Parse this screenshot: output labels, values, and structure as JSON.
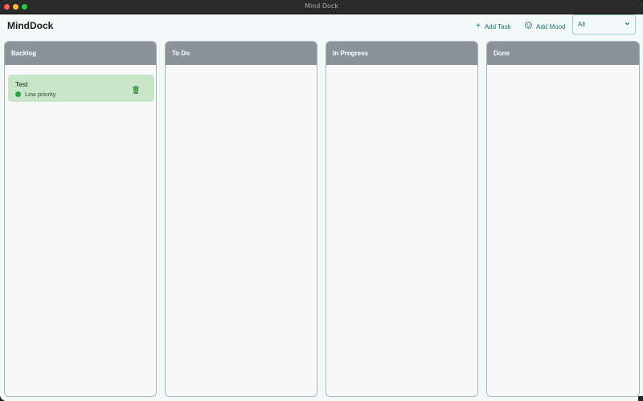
{
  "window": {
    "title": "Mind Dock"
  },
  "header": {
    "app_title": "MindDock",
    "add_task_label": "Add Task",
    "add_mood_label": "Add Mood",
    "filter_value": "All"
  },
  "columns": [
    {
      "title": "Backlog",
      "cards": [
        {
          "title": "Test",
          "priority": "Low priority",
          "priority_color": "#2ea043"
        }
      ]
    },
    {
      "title": "To Do",
      "cards": []
    },
    {
      "title": "In Progress",
      "cards": []
    },
    {
      "title": "Done",
      "cards": []
    }
  ],
  "colors": {
    "accent": "#1a6e74",
    "column_header": "#8a9399",
    "card_background": "#c9e6c9",
    "delete_icon": "#3d8c3d"
  },
  "icons": {
    "add_task": "plus-icon",
    "add_mood": "smiley-icon",
    "filter": "chevron-down-icon",
    "card_delete": "trash-icon"
  }
}
